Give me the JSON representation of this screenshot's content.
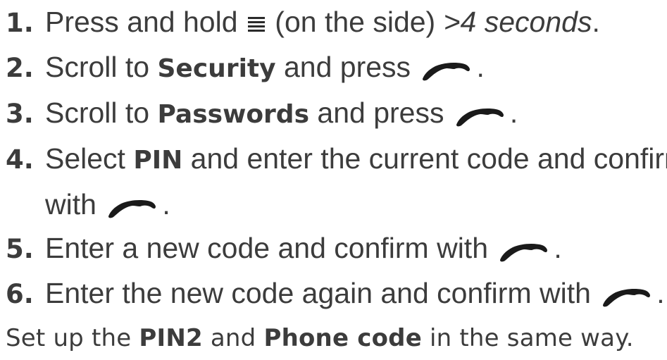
{
  "steps": [
    {
      "num": "1.",
      "before": "Press and hold ",
      "icon": "menu-icon",
      "after": " (on the side) ",
      "italic": ">4 seconds",
      "end": "."
    },
    {
      "num": "2.",
      "before": "Scroll to ",
      "bold": "Security",
      "after": " and press ",
      "icon": "call-handset-icon",
      "end": "."
    },
    {
      "num": "3.",
      "before": "Scroll to ",
      "bold": "Passwords",
      "after": " and press ",
      "icon": "call-handset-icon",
      "end": "."
    },
    {
      "num": "4.",
      "before": "Select ",
      "bold": "PIN",
      "after": " and enter the current code and confirm",
      "cont": "with ",
      "icon": "call-handset-icon",
      "end": "."
    },
    {
      "num": "5.",
      "before": "Enter a new code and confirm with ",
      "icon": "call-handset-icon",
      "end": "."
    },
    {
      "num": "6.",
      "before": "Enter the new code again and confirm with ",
      "icon": "call-handset-icon",
      "end": "."
    }
  ],
  "footer": {
    "before": "Set up the ",
    "bold1": "PIN2",
    "mid": " and ",
    "bold2": "Phone code",
    "after": " in the same way."
  },
  "colors": {
    "text": "#3c3c3c",
    "icon": "#1a1a1a"
  }
}
